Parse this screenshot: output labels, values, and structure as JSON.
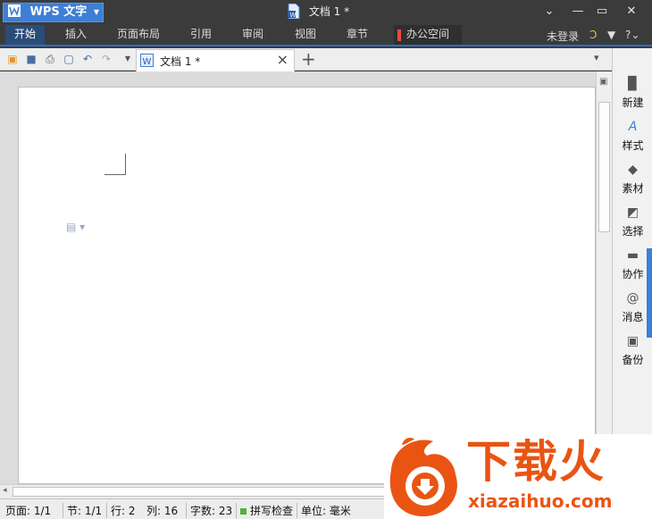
{
  "titlebar": {
    "app_name": "WPS 文字",
    "doc_title": "文档 1 *",
    "controls": {
      "menu": "⌄",
      "minimize": "—",
      "maximize": "▭",
      "close": "✕"
    }
  },
  "tabs": [
    "开始",
    "插入",
    "页面布局",
    "引用",
    "审阅",
    "视图",
    "章节",
    "办公空间"
  ],
  "account": {
    "login": "未登录"
  },
  "toolbar": {
    "doc_tab": "文档 1 *"
  },
  "side_panel": [
    "新建",
    "样式",
    "素材",
    "选择",
    "协作",
    "消息",
    "备份"
  ],
  "statusbar": {
    "page": "页面: 1/1",
    "section": "节: 1/1",
    "row": "行: 2",
    "col": "列: 16",
    "words": "字数: 23",
    "spell": "拼写检查",
    "unit": "单位: 毫米"
  },
  "watermark": {
    "brand": "下载火",
    "url": "xiazaihuo.com"
  },
  "colors": {
    "accent": "#3d7fd6",
    "titlebar": "#3b3b3b",
    "watermark": "#ea5413"
  }
}
